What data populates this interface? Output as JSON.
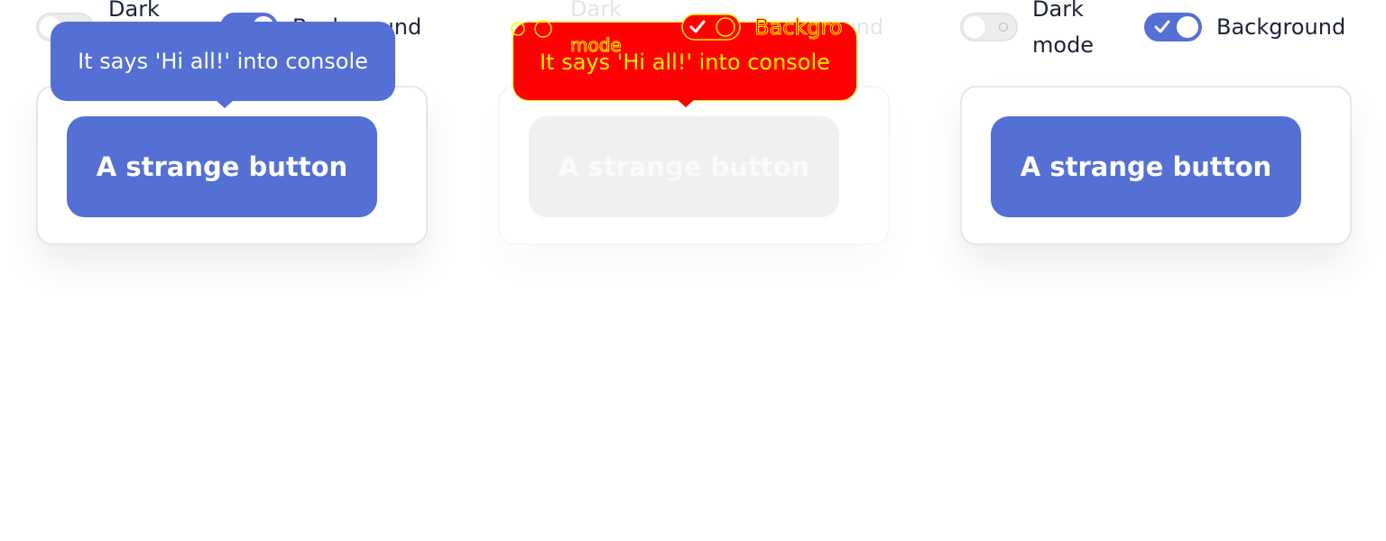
{
  "panels": [
    {
      "dark_mode_label": "Dark mode",
      "dark_mode_on": false,
      "background_label": "Background",
      "background_on": true,
      "button_label": "A strange button",
      "tooltip_text": "It says 'Hi all!' into console"
    },
    {
      "dark_mode_label": "Dark mode",
      "dark_mode_on": false,
      "background_label": "Background",
      "background_on": true,
      "button_label": "A strange button",
      "tooltip_text": "It says 'Hi all!' into console"
    },
    {
      "dark_mode_label": "Dark mode",
      "dark_mode_on": false,
      "background_label": "Background",
      "background_on": true,
      "button_label": "A strange button",
      "tooltip_text": ""
    }
  ],
  "colors": {
    "accent": "#5470d5",
    "toggle_off": "#ececec",
    "debug_fill": "#ff0000",
    "debug_outline": "#fff200"
  },
  "icons": {
    "toggle_on": "check-icon",
    "toggle_off": "circle-icon"
  }
}
